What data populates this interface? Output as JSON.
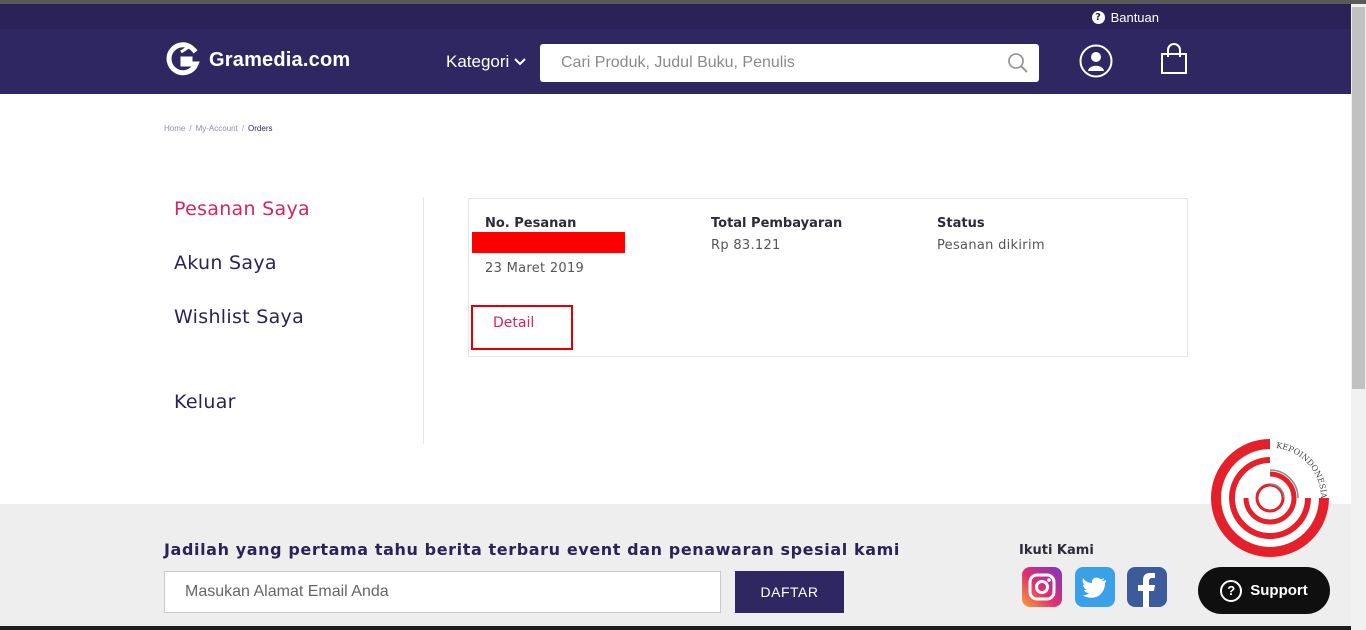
{
  "topbar": {
    "help_label": "Bantuan"
  },
  "header": {
    "brand": "Gramedia.com",
    "category_label": "Kategori",
    "search_placeholder": "Cari Produk, Judul Buku, Penulis"
  },
  "breadcrumb": {
    "home": "Home",
    "sep": "/",
    "account": "My-Account",
    "current": "Orders"
  },
  "sidebar": {
    "items": [
      {
        "label": "Pesanan Saya",
        "active": true
      },
      {
        "label": "Akun Saya",
        "active": false
      },
      {
        "label": "Wishlist Saya",
        "active": false
      },
      {
        "label": "Keluar",
        "active": false
      }
    ]
  },
  "order": {
    "number_label": "No. Pesanan",
    "date": "23 Maret 2019",
    "total_label": "Total Pembayaran",
    "total_value": "Rp 83.121",
    "status_label": "Status",
    "status_value": "Pesanan dikirim",
    "detail_label": "Detail"
  },
  "footer": {
    "newsletter_title": "Jadilah yang pertama tahu berita terbaru event dan penawaran spesial kami",
    "email_placeholder": "Masukan Alamat Email Anda",
    "subscribe_label": "DAFTAR",
    "follow_label": "Ikuti Kami",
    "social": [
      "instagram-icon",
      "twitter-icon",
      "facebook-icon"
    ]
  },
  "support": {
    "label": "Support"
  },
  "watermark": {
    "text": "KEPOINDONESIA"
  },
  "colors": {
    "brand_navy": "#2f2761",
    "accent_pink": "#d6245e",
    "redaction": "#ff0000"
  }
}
